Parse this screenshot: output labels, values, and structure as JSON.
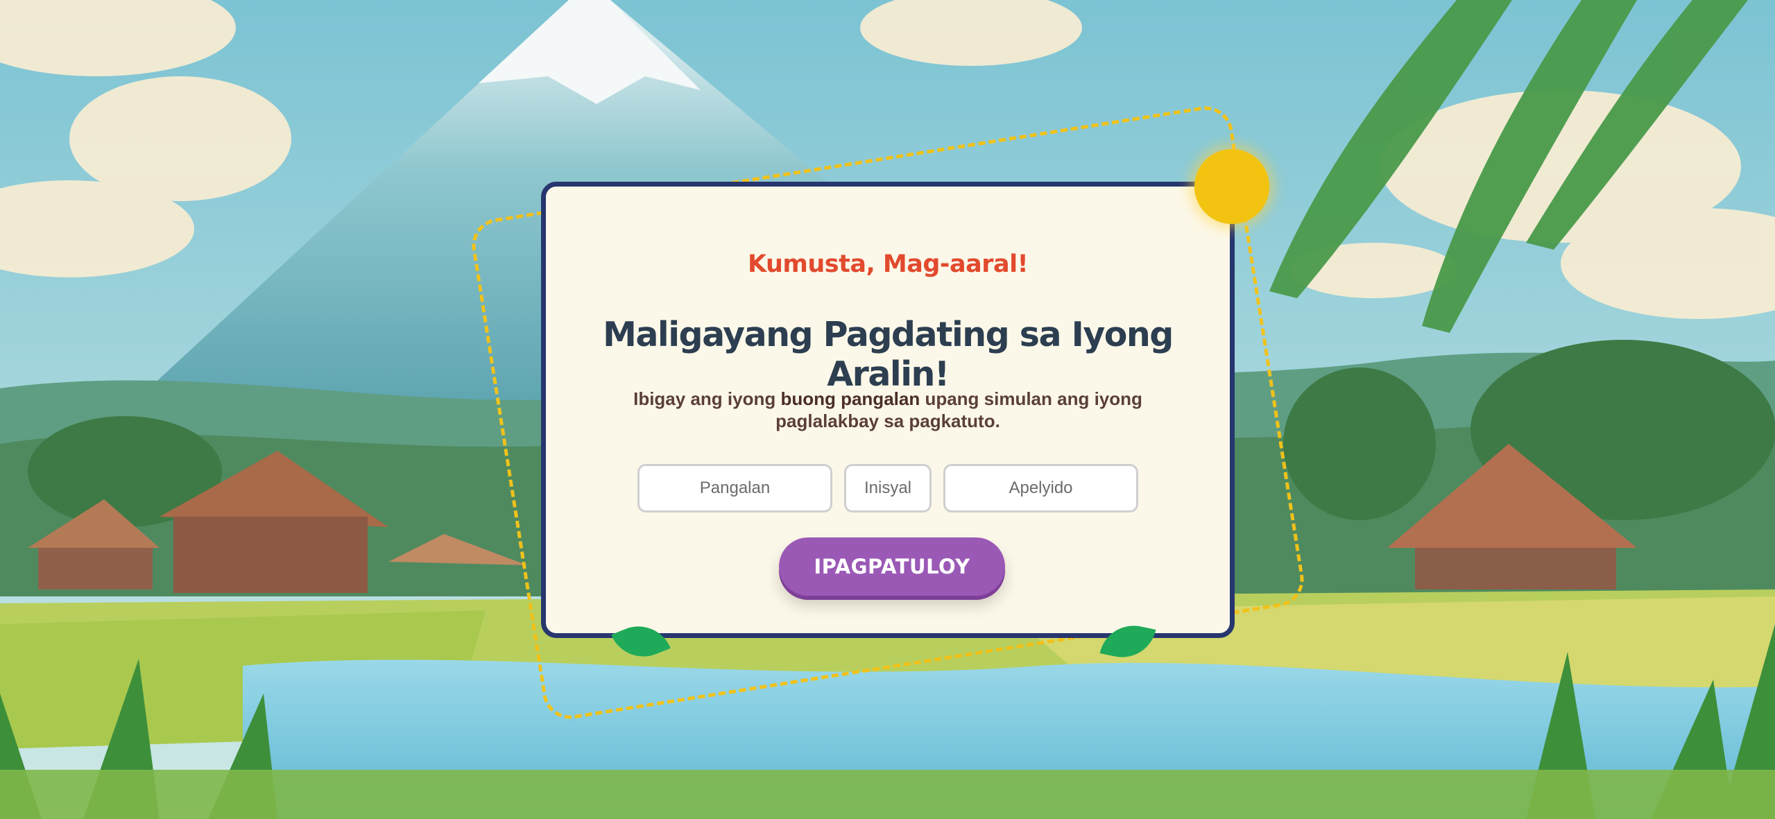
{
  "background": {
    "scene": "mountain-rice-field-village",
    "sky_color": "#9fd4dc",
    "accent_sun": "#f2c311",
    "leaf_color": "#1faa59"
  },
  "card": {
    "greeting": "Kumusta, Mag-aaral!",
    "headline": "Maligayang Pagdating sa Iyong Aralin!",
    "instruction_before": "Ibigay ang iyong ",
    "instruction_bold": "buong pangalan",
    "instruction_after": " upang simulan ang iyong paglalakbay sa pagkatuto.",
    "colors": {
      "greeting": "#e24a2e",
      "headline": "#2c3e50",
      "border": "#27366e",
      "button": "#9b59b6"
    }
  },
  "form": {
    "first_name": {
      "placeholder": "Pangalan",
      "value": ""
    },
    "middle_initial": {
      "placeholder": "Inisyal",
      "value": ""
    },
    "last_name": {
      "placeholder": "Apelyido",
      "value": ""
    },
    "submit_label": "IPAGPATULOY"
  }
}
